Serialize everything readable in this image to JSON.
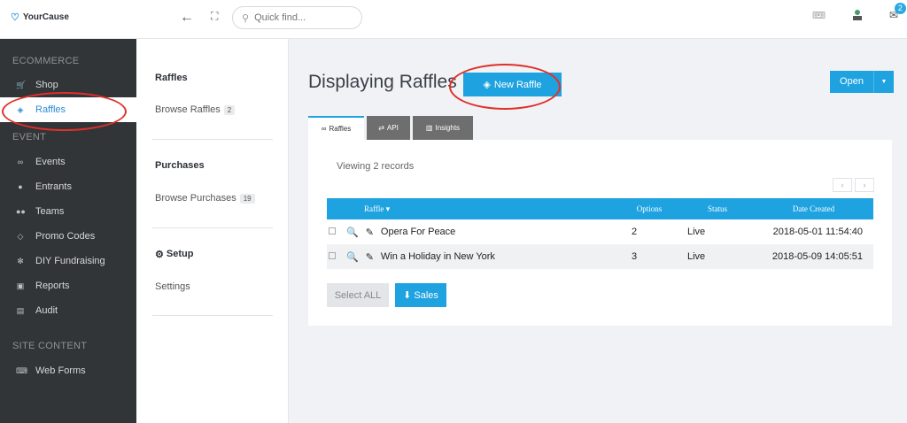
{
  "app": {
    "logo_text": "YourCause"
  },
  "topbar": {
    "search_placeholder": "Quick find...",
    "mail_count": "2"
  },
  "sidebar": {
    "sections": [
      {
        "title": "ECOMMERCE",
        "items": [
          {
            "label": "Shop",
            "icon": "cart-icon"
          },
          {
            "label": "Raffles",
            "icon": "ticket-icon",
            "active": true
          }
        ]
      },
      {
        "title": "EVENT",
        "items": [
          {
            "label": "Events",
            "icon": "binoculars-icon"
          },
          {
            "label": "Entrants",
            "icon": "user-icon"
          },
          {
            "label": "Teams",
            "icon": "users-icon"
          },
          {
            "label": "Promo Codes",
            "icon": "tag-icon"
          },
          {
            "label": "DIY Fundraising",
            "icon": "gear-icon"
          },
          {
            "label": "Reports",
            "icon": "report-icon"
          },
          {
            "label": "Audit",
            "icon": "audit-icon"
          }
        ]
      },
      {
        "title": "SITE CONTENT",
        "items": [
          {
            "label": "Web Forms",
            "icon": "keyboard-icon"
          }
        ]
      }
    ]
  },
  "subnav": {
    "raffles_title": "Raffles",
    "browse_raffles": "Browse Raffles",
    "browse_raffles_count": "2",
    "purchases_title": "Purchases",
    "browse_purchases": "Browse Purchases",
    "browse_purchases_count": "19",
    "setup_title": "Setup",
    "settings": "Settings"
  },
  "main": {
    "title": "Displaying Raffles",
    "new_button": "New Raffle",
    "open_button": "Open",
    "tabs": [
      "Raffles",
      "API",
      "Insights"
    ],
    "records": "Viewing 2 records",
    "pager_prev": "‹",
    "pager_next": "›",
    "columns": {
      "raffle": "Raffle ▾",
      "options": "Options",
      "status": "Status",
      "date": "Date Created"
    },
    "rows": [
      {
        "name": "Opera For Peace",
        "options": "2",
        "status": "Live",
        "date": "2018-05-01 11:54:40"
      },
      {
        "name": "Win a Holiday in New York",
        "options": "3",
        "status": "Live",
        "date": "2018-05-09 14:05:51"
      }
    ],
    "select_all": "Select ALL",
    "sales": "Sales"
  },
  "colors": {
    "accent": "#1ea2e0",
    "sidebar": "#323538",
    "annotation": "#e0302a"
  }
}
